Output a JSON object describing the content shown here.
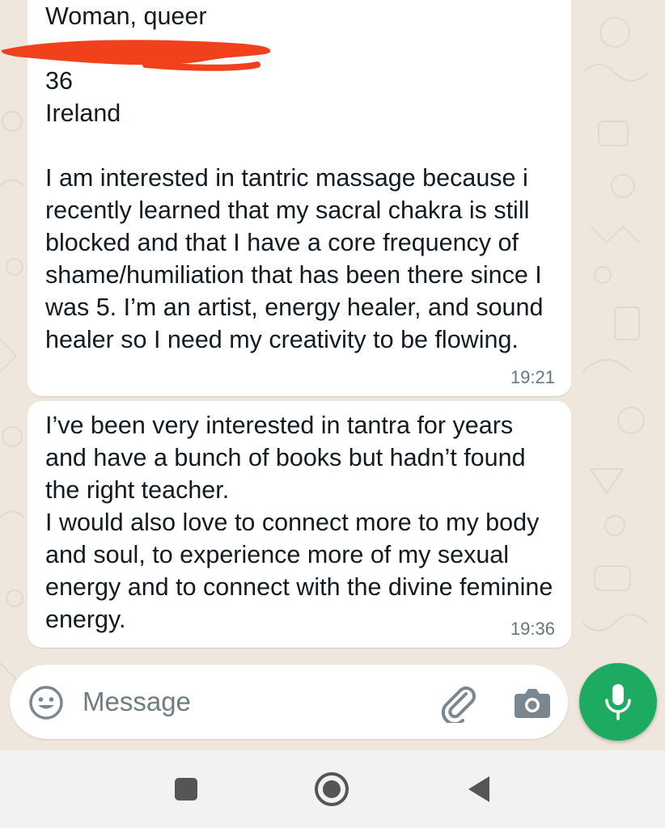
{
  "messages": [
    {
      "text": "Woman, queer\n\n36\nIreland\n\nI am interested in tantric massage because i recently learned that my sacral chakra is still blocked and that I have a core frequency of shame/humiliation that has been there since I was 5. I’m an artist, energy healer, and sound healer so I need my creativity to be flowing.",
      "time": "19:21"
    },
    {
      "text": "I’ve been very interested in tantra for years and have a bunch of books but hadn’t found the right teacher.\nI would also love to connect more to my body and soul, to experience more of my sexual energy and to connect with the divine feminine energy.",
      "time": "19:36"
    }
  ],
  "composer": {
    "placeholder": "Message",
    "value": ""
  },
  "icons": {
    "emoji": "emoji-icon",
    "attach": "paperclip-icon",
    "camera": "camera-icon",
    "mic": "microphone-icon",
    "nav_recents": "square-icon",
    "nav_home": "circle-icon",
    "nav_back": "triangle-back-icon"
  },
  "colors": {
    "chat_background": "#efe7dd",
    "bubble": "#ffffff",
    "accent_green": "#1daa61",
    "redaction": "#f0401c"
  }
}
